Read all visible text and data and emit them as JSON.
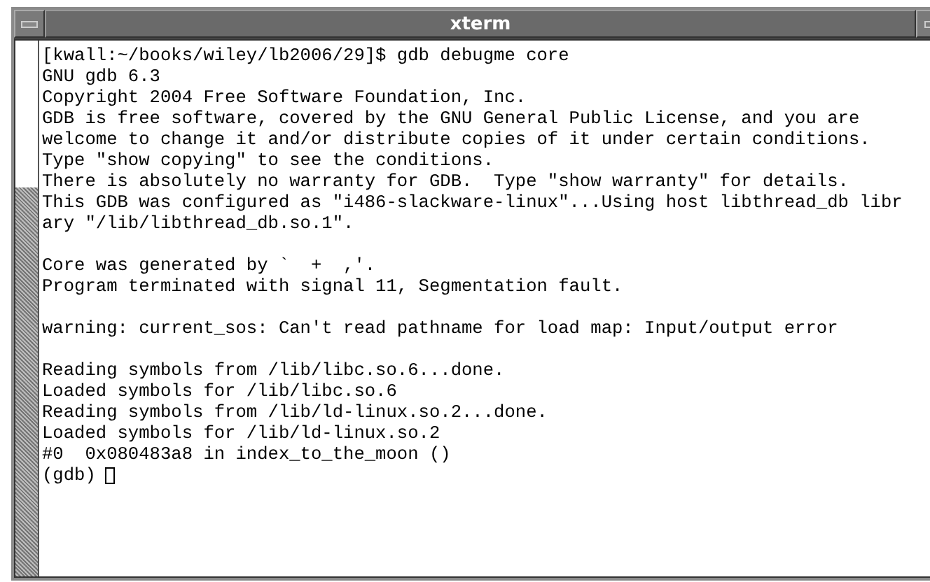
{
  "window": {
    "title": "xterm"
  },
  "terminal": {
    "blocks": [
      [
        "[kwall:~/books/wiley/lb2006/29]$ gdb debugme core",
        "GNU gdb 6.3",
        "Copyright 2004 Free Software Foundation, Inc.",
        "GDB is free software, covered by the GNU General Public License, and you are",
        "welcome to change it and/or distribute copies of it under certain conditions.",
        "Type \"show copying\" to see the conditions.",
        "There is absolutely no warranty for GDB.  Type \"show warranty\" for details.",
        "This GDB was configured as \"i486-slackware-linux\"...Using host libthread_db libr",
        "ary \"/lib/libthread_db.so.1\"."
      ],
      [
        "Core was generated by `  +  ,'.",
        "Program terminated with signal 11, Segmentation fault."
      ],
      [
        "warning: current_sos: Can't read pathname for load map: Input/output error"
      ],
      [
        "Reading symbols from /lib/libc.so.6...done.",
        "Loaded symbols for /lib/libc.so.6",
        "Reading symbols from /lib/ld-linux.so.2...done.",
        "Loaded symbols for /lib/ld-linux.so.2",
        "#0  0x080483a8 in index_to_the_moon ()"
      ]
    ],
    "prompt": "(gdb)"
  }
}
